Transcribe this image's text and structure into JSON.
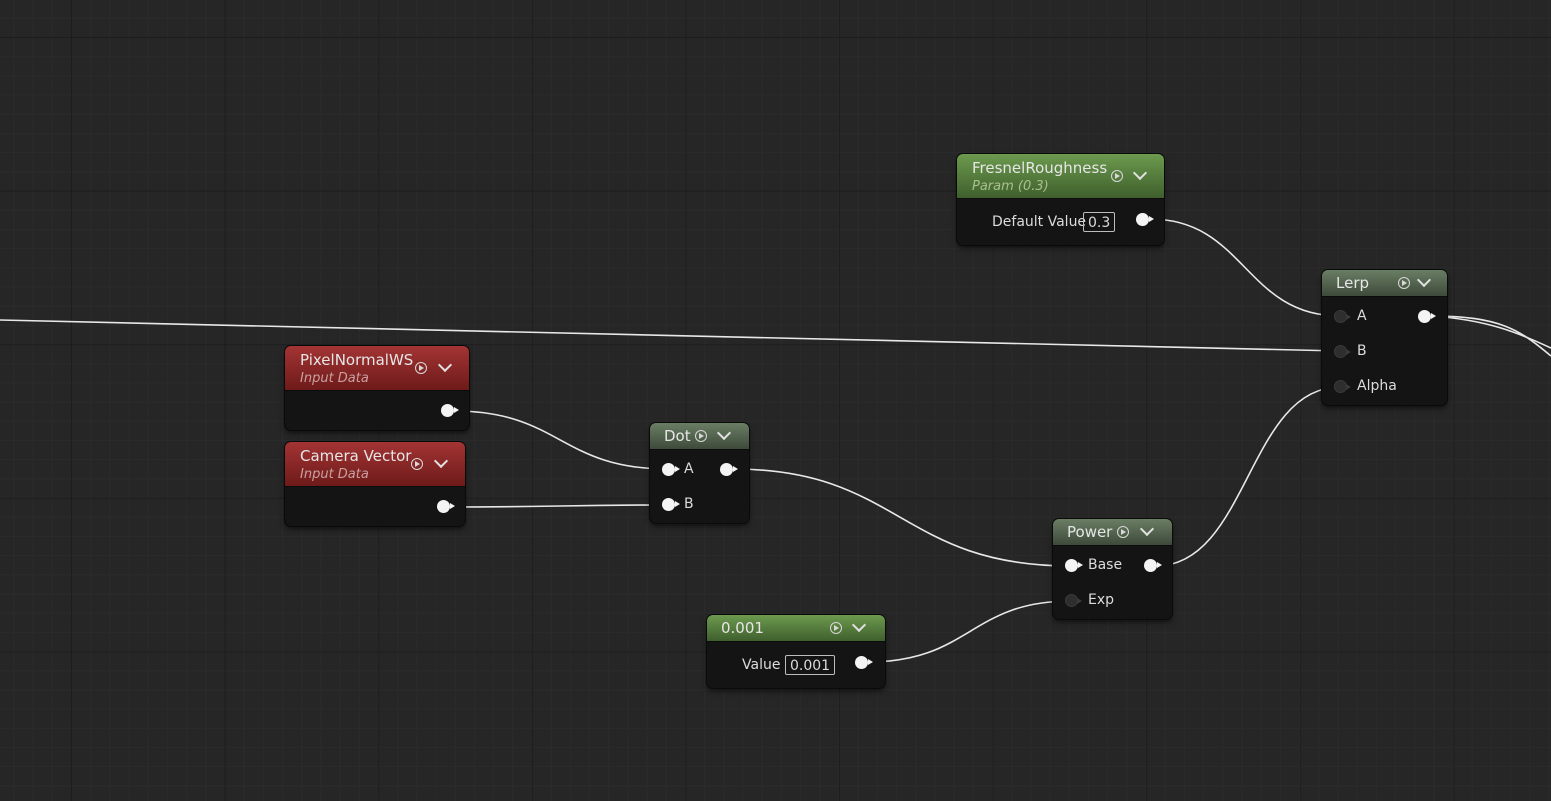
{
  "nodes": {
    "fresnel_roughness": {
      "title": "FresnelRoughness",
      "subtitle": "Param (0.3)",
      "pin_label": "Default Value",
      "value": "0.3",
      "header_color": "#5e8a42"
    },
    "lerp": {
      "title": "Lerp",
      "pins": {
        "a": "A",
        "b": "B",
        "alpha": "Alpha"
      },
      "header_color": "#5a6e55"
    },
    "pixel_normal": {
      "title": "PixelNormalWS",
      "subtitle": "Input Data",
      "header_color": "#8e2a2a"
    },
    "camera_vector": {
      "title": "Camera Vector",
      "subtitle": "Input Data",
      "header_color": "#8e2a2a"
    },
    "dot": {
      "title": "Dot",
      "pins": {
        "a": "A",
        "b": "B"
      },
      "header_color": "#5a6e55"
    },
    "power": {
      "title": "Power",
      "pins": {
        "base": "Base",
        "exp": "Exp"
      },
      "header_color": "#5a6e55"
    },
    "constant": {
      "title": "0.001",
      "pin_label": "Value",
      "value": "0.001",
      "header_color": "#5e8a42"
    }
  },
  "colors": {
    "background": "#262626",
    "wire": "#e8e8e8",
    "node_body": "#141414"
  },
  "icons": {
    "preview": "play-circle-icon",
    "collapse": "chevron-down-icon"
  }
}
